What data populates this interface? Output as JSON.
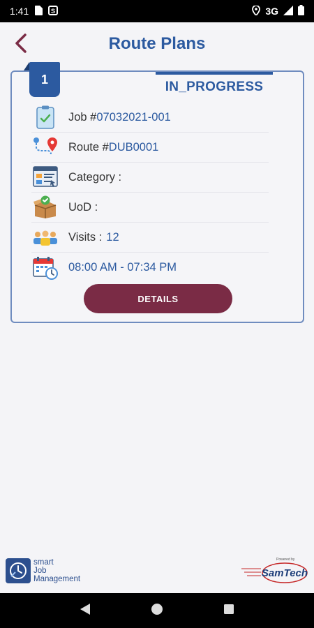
{
  "status_bar": {
    "time": "1:41",
    "network": "3G"
  },
  "header": {
    "title": "Route Plans"
  },
  "card": {
    "index": "1",
    "status": "IN_PROGRESS",
    "job": {
      "label": "Job #",
      "value": "07032021-001"
    },
    "route": {
      "label": "Route #",
      "value": "DUB0001"
    },
    "category": {
      "label": "Category :",
      "value": ""
    },
    "uod": {
      "label": "UoD :",
      "value": ""
    },
    "visits": {
      "label": "Visits :",
      "value": "12"
    },
    "time_range": "08:00 AM - 07:34 PM",
    "details_label": "DETAILS"
  },
  "footer": {
    "app_logo": {
      "line1": "smart",
      "line2": "Job",
      "line3": "Management"
    },
    "powered_by": "Powered by",
    "brand": "SamTech"
  },
  "colors": {
    "primary": "#2c5aa0",
    "accent": "#7a2b45",
    "background": "#f4f4f7"
  }
}
